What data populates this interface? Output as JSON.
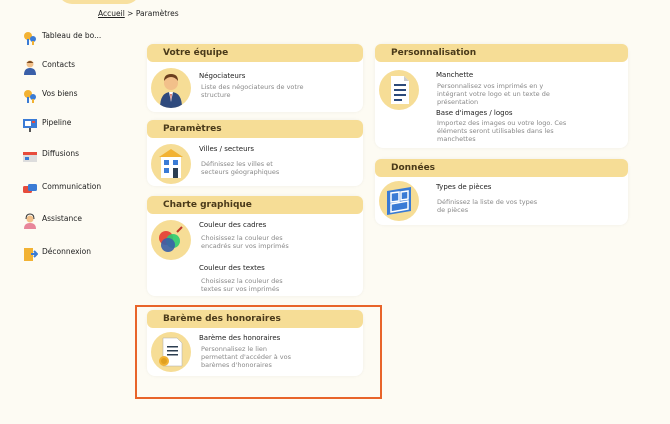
{
  "breadcrumb": {
    "home": "Accueil",
    "sep": ">",
    "current": "Paramètres"
  },
  "sidebar": {
    "items": [
      {
        "label": "Tableau de bo...",
        "icon": "dashboard-icon"
      },
      {
        "label": "Contacts",
        "icon": "contacts-icon"
      },
      {
        "label": "Vos biens",
        "icon": "properties-icon"
      },
      {
        "label": "Pipeline",
        "icon": "pipeline-icon"
      },
      {
        "label": "Diffusions",
        "icon": "diffusions-icon"
      },
      {
        "label": "Communication",
        "icon": "communication-icon"
      },
      {
        "label": "Assistance",
        "icon": "assistance-icon"
      },
      {
        "label": "Déconnexion",
        "icon": "logout-icon"
      }
    ]
  },
  "sections": {
    "equipe": {
      "title": "Votre équipe",
      "items": [
        {
          "title": "Négociateurs",
          "desc": [
            "Liste des négociateurs de votre",
            "structure"
          ]
        }
      ]
    },
    "parametres": {
      "title": "Paramètres",
      "items": [
        {
          "title": "Villes / secteurs",
          "desc": [
            "Définissez les villes et",
            "secteurs géographiques"
          ]
        }
      ]
    },
    "charte": {
      "title": "Charte graphique",
      "items": [
        {
          "title": "Couleur des cadres",
          "desc": [
            "Choisissez la couleur des",
            "encadrés sur vos imprimés"
          ]
        },
        {
          "title": "Couleur des textes",
          "desc": [
            "Choisissez la couleur des",
            "textes sur vos imprimés"
          ]
        }
      ]
    },
    "bareme": {
      "title": "Barème des honoraires",
      "items": [
        {
          "title": "Barème des honoraires",
          "desc": [
            "Personnalisez le lien",
            "permettant d'accéder à vos",
            "barèmes d'honoraires"
          ]
        }
      ]
    },
    "perso": {
      "title": "Personnalisation",
      "items": [
        {
          "title": "Manchette",
          "desc": [
            "Personnalisez vos imprimés en y",
            "intégrant votre logo et un texte de",
            "présentation"
          ]
        },
        {
          "title": "Base d'images / logos",
          "desc": [
            "Importez des images ou votre logo. Ces",
            "éléments seront utilisables dans les",
            "manchettes"
          ]
        }
      ]
    },
    "donnees": {
      "title": "Données",
      "items": [
        {
          "title": "Types de pièces",
          "desc": [
            "Définissez la liste de vos types",
            "de pièces"
          ]
        }
      ]
    }
  },
  "colors": {
    "accent": "#f6dd96",
    "highlight": "#e8642a",
    "background": "#fdfbf3"
  }
}
